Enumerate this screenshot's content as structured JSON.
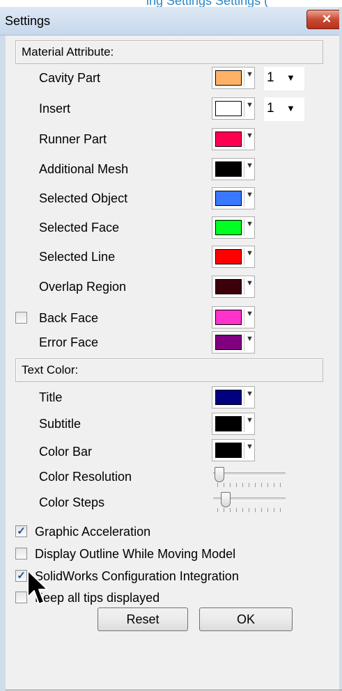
{
  "window": {
    "title": "Settings",
    "close_glyph": "✕"
  },
  "top_strip_text": "ing  Settings  Settings  (",
  "material_section": "Material Attribute:",
  "material_rows": [
    {
      "label": "Cavity Part",
      "color": "#ffb266",
      "spinner": "1"
    },
    {
      "label": "Insert",
      "color": "#ffffff",
      "spinner": "1"
    },
    {
      "label": "Runner Part",
      "color": "#ff0050"
    },
    {
      "label": "Additional Mesh",
      "color": "#000000"
    },
    {
      "label": "Selected Object",
      "color": "#3a78ff"
    },
    {
      "label": "Selected Face",
      "color": "#00ff22"
    },
    {
      "label": "Selected Line",
      "color": "#ff0000"
    },
    {
      "label": "Overlap Region",
      "color": "#3c000a"
    },
    {
      "label": "Back Face",
      "color": "#ff33cc",
      "checked": false
    },
    {
      "label": "Error Face",
      "color": "#800080"
    }
  ],
  "text_section": "Text Color:",
  "text_rows": [
    {
      "label": "Title",
      "color": "#000080"
    },
    {
      "label": "Subtitle",
      "color": "#000000"
    },
    {
      "label": "Color Bar",
      "color": "#000000"
    }
  ],
  "sliders": [
    {
      "label": "Color Resolution",
      "value_fraction": 0.0
    },
    {
      "label": "Color Steps",
      "value_fraction": 0.1
    }
  ],
  "options": [
    {
      "label": "Graphic Acceleration",
      "checked": true
    },
    {
      "label": "Display Outline While Moving Model",
      "checked": false
    },
    {
      "label": "SolidWorks Configuration Integration",
      "checked": true
    },
    {
      "label": "Keep all tips displayed",
      "checked": false
    }
  ],
  "buttons": {
    "reset": "Reset",
    "ok": "OK"
  },
  "check_glyph": "✓",
  "arrow_glyph": "▼"
}
